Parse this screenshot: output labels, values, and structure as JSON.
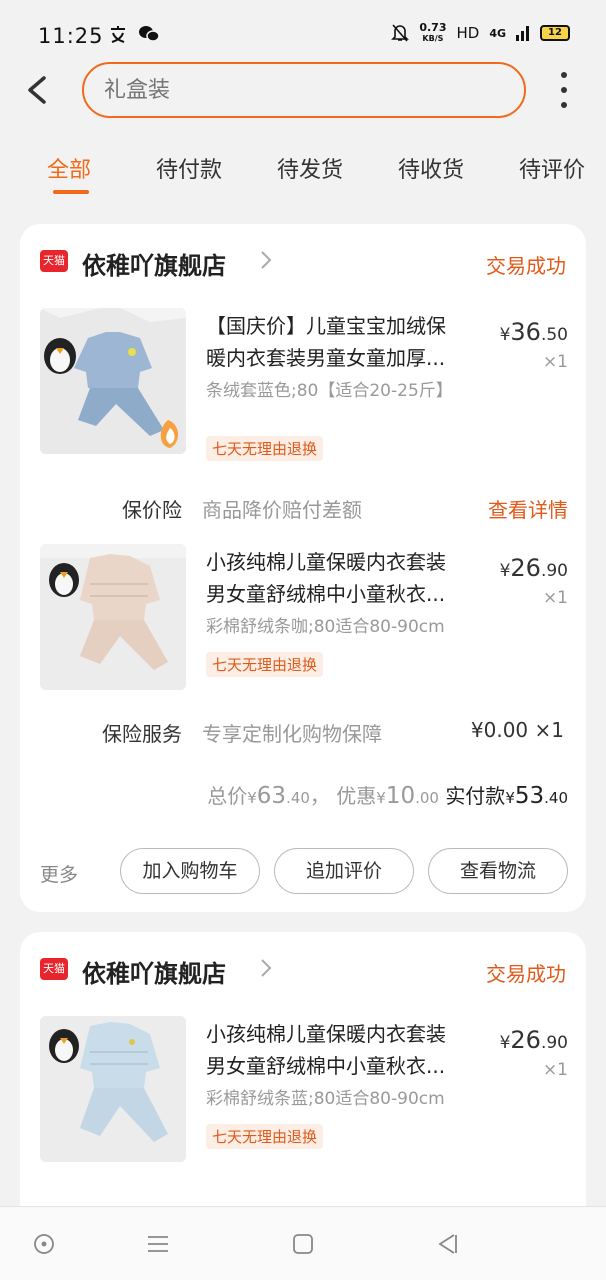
{
  "status_bar": {
    "time": "11:25",
    "speed_value": "0.73",
    "speed_unit": "KB/S",
    "hd": "HD",
    "network": "4G",
    "battery": "12"
  },
  "search": {
    "placeholder": "礼盒装"
  },
  "tabs": [
    {
      "label": "全部",
      "active": true
    },
    {
      "label": "待付款"
    },
    {
      "label": "待发货"
    },
    {
      "label": "待收货"
    },
    {
      "label": "待评价"
    }
  ],
  "orders": [
    {
      "shop_badge": "天猫",
      "shop_name": "依稚吖旗舰店",
      "status": "交易成功",
      "items": [
        {
          "title_l1": "【国庆价】儿童宝宝加绒保",
          "title_l2": "暖内衣套装男童女童加厚...",
          "sku": "条绒套蓝色;80【适合20-25斤】",
          "tag": "七天无理由退换",
          "price_symbol": "¥",
          "price_int": "36",
          "price_dec": ".50",
          "qty": "×1"
        },
        {
          "title_l1": "小孩纯棉儿童保暖内衣套装",
          "title_l2": "男女童舒绒棉中小童秋衣...",
          "sku": "彩棉舒绒条咖;80适合80-90cm",
          "tag": "七天无理由退换",
          "price_symbol": "¥",
          "price_int": "26",
          "price_dec": ".90",
          "qty": "×1"
        }
      ],
      "price_protect": {
        "label": "保价险",
        "desc": "商品降价赔付差额",
        "link": "查看详情"
      },
      "insurance": {
        "label": "保险服务",
        "desc": "专享定制化购物保障",
        "price": "¥0.00 ×1"
      },
      "totals": {
        "total_label": "总价",
        "yen": "¥",
        "total_int": "63",
        "total_dec": ".40",
        "sep": "，",
        "discount_label": "优惠",
        "discount_int": "10",
        "discount_dec": ".00",
        "paid_label": "实付款",
        "paid_int": "53",
        "paid_dec": ".40"
      },
      "actions": {
        "more": "更多",
        "add_cart": "加入购物车",
        "add_review": "追加评价",
        "logistics": "查看物流"
      }
    },
    {
      "shop_badge": "天猫",
      "shop_name": "依稚吖旗舰店",
      "status": "交易成功",
      "items": [
        {
          "title_l1": "小孩纯棉儿童保暖内衣套装",
          "title_l2": "男女童舒绒棉中小童秋衣...",
          "sku": "彩棉舒绒条蓝;80适合80-90cm",
          "tag": "七天无理由退换",
          "price_symbol": "¥",
          "price_int": "26",
          "price_dec": ".90",
          "qty": "×1"
        }
      ]
    }
  ]
}
